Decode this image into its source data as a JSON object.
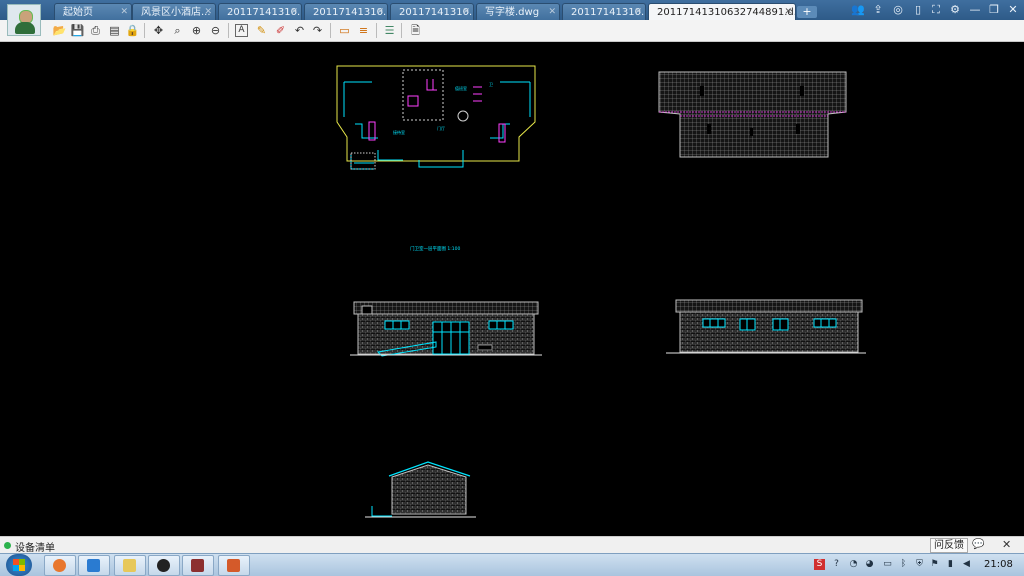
{
  "tabs": [
    {
      "label": "起始页"
    },
    {
      "label": "风景区小酒店..."
    },
    {
      "label": "20117141310..."
    },
    {
      "label": "20117141310..."
    },
    {
      "label": "20117141310..."
    },
    {
      "label": "写字楼.dwg"
    },
    {
      "label": "20117141310..."
    },
    {
      "label": "20117141310632744891.d..."
    }
  ],
  "newtab_label": "+",
  "window_icons": [
    "people-icon",
    "share-icon",
    "wechat-icon",
    "mobile-icon",
    "fullscreen-icon",
    "settings-icon",
    "minimize-icon",
    "restore-icon",
    "close-icon"
  ],
  "toolbar_icons": [
    "open-icon",
    "save-icon",
    "print-icon",
    "pdf-icon",
    "lock-icon",
    "pan-icon",
    "zoom-window-icon",
    "zoom-in-icon",
    "zoom-out-icon",
    "text-icon",
    "pencil-icon",
    "markup-icon",
    "undo-icon",
    "redo-icon",
    "measure-icon",
    "dimension-icon",
    "layers-icon",
    "properties-icon"
  ],
  "drawing": {
    "plan_label": "门卫室一层平面图 1:100",
    "colors": {
      "cyan": "#00e5ff",
      "yellow": "#e9e94a",
      "magenta": "#ff40ff",
      "white": "#e6e6e6",
      "grid": "#9a9a9a"
    }
  },
  "status": {
    "text": "设备清单",
    "feedback": "问反馈",
    "close": "✕"
  },
  "taskbar": {
    "clock": "21:08"
  }
}
